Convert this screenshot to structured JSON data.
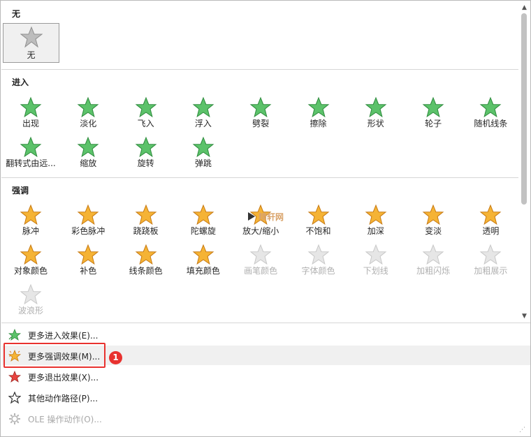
{
  "sections": {
    "none_title": "无",
    "entrance_title": "进入",
    "emphasis_title": "强调"
  },
  "none_effect": {
    "label": "无",
    "icon": "star-outline-grey-icon"
  },
  "entrance": [
    {
      "label": "出现",
      "icon": "star-appear-icon"
    },
    {
      "label": "淡化",
      "icon": "star-fade-icon"
    },
    {
      "label": "飞入",
      "icon": "star-fly-in-icon"
    },
    {
      "label": "浮入",
      "icon": "star-float-in-icon"
    },
    {
      "label": "劈裂",
      "icon": "star-split-icon"
    },
    {
      "label": "擦除",
      "icon": "star-wipe-icon"
    },
    {
      "label": "形状",
      "icon": "star-shape-icon"
    },
    {
      "label": "轮子",
      "icon": "star-wheel-icon"
    },
    {
      "label": "随机线条",
      "icon": "star-random-bars-icon"
    },
    {
      "label": "翻转式由远...",
      "icon": "star-grow-turn-icon"
    },
    {
      "label": "缩放",
      "icon": "star-zoom-icon"
    },
    {
      "label": "旋转",
      "icon": "star-swivel-icon"
    },
    {
      "label": "弹跳",
      "icon": "star-bounce-icon"
    }
  ],
  "emphasis": [
    {
      "label": "脉冲",
      "icon": "star-pulse-icon",
      "disabled": false
    },
    {
      "label": "彩色脉冲",
      "icon": "star-color-pulse-icon",
      "disabled": false
    },
    {
      "label": "跷跷板",
      "icon": "star-teeter-icon",
      "disabled": false
    },
    {
      "label": "陀螺旋",
      "icon": "star-spin-icon",
      "disabled": false
    },
    {
      "label": "放大/缩小",
      "icon": "star-grow-shrink-icon",
      "disabled": false
    },
    {
      "label": "不饱和",
      "icon": "star-desaturate-icon",
      "disabled": false
    },
    {
      "label": "加深",
      "icon": "star-darken-icon",
      "disabled": false
    },
    {
      "label": "变淡",
      "icon": "star-lighten-icon",
      "disabled": false
    },
    {
      "label": "透明",
      "icon": "star-transparency-icon",
      "disabled": false
    },
    {
      "label": "对象颜色",
      "icon": "star-object-color-icon",
      "disabled": false
    },
    {
      "label": "补色",
      "icon": "star-complementary-color-icon",
      "disabled": false
    },
    {
      "label": "线条颜色",
      "icon": "star-line-color-icon",
      "disabled": false
    },
    {
      "label": "填充颜色",
      "icon": "star-fill-color-icon",
      "disabled": false
    },
    {
      "label": "画笔颜色",
      "icon": "star-brush-color-icon",
      "disabled": true
    },
    {
      "label": "字体颜色",
      "icon": "star-font-color-icon",
      "disabled": true
    },
    {
      "label": "下划线",
      "icon": "star-underline-icon",
      "disabled": true
    },
    {
      "label": "加粗闪烁",
      "icon": "star-bold-flash-icon",
      "disabled": true
    },
    {
      "label": "加粗展示",
      "icon": "star-bold-reveal-icon",
      "disabled": true
    },
    {
      "label": "波浪形",
      "icon": "star-wave-icon",
      "disabled": true
    }
  ],
  "menu": [
    {
      "label": "更多进入效果(E)...",
      "icon": "green-star-icon",
      "disabled": false
    },
    {
      "label": "更多强调效果(M)...",
      "icon": "gold-star-burst-icon",
      "disabled": false
    },
    {
      "label": "更多退出效果(X)...",
      "icon": "red-star-icon",
      "disabled": false
    },
    {
      "label": "其他动作路径(P)...",
      "icon": "star-outline-icon",
      "disabled": false
    },
    {
      "label": "OLE 操作动作(O)...",
      "icon": "gear-icon",
      "disabled": true
    }
  ],
  "annotation": {
    "badge": "1"
  },
  "watermark": {
    "text": "精轩网"
  },
  "colors": {
    "entrance_green": "#5cc26a",
    "emphasis_gold": "#f5b335",
    "exit_red": "#e8433f",
    "highlight_red": "#e8322f",
    "disabled_grey": "#c8c8c8"
  }
}
